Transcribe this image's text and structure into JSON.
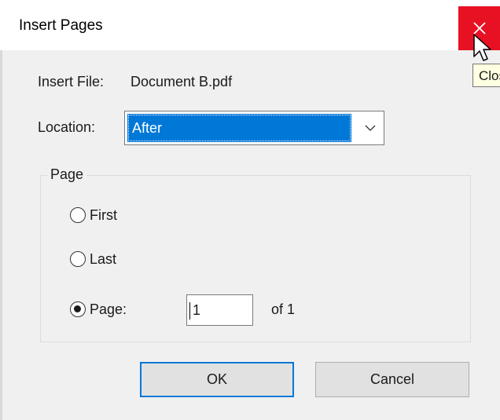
{
  "window": {
    "title": "Insert Pages",
    "close_tooltip": "Close"
  },
  "insert_file": {
    "label": "Insert File:",
    "value": "Document B.pdf"
  },
  "location": {
    "label": "Location:",
    "selected": "After"
  },
  "page_group": {
    "legend": "Page",
    "options": [
      {
        "label": "First",
        "checked": false
      },
      {
        "label": "Last",
        "checked": false
      },
      {
        "label": "Page:",
        "checked": true
      }
    ],
    "page_number": "1",
    "of_label": "of 1"
  },
  "buttons": {
    "ok": "OK",
    "cancel": "Cancel"
  },
  "colors": {
    "close_hover": "#e81123",
    "selection": "#0078d7",
    "default_button_border": "#0078d7"
  }
}
